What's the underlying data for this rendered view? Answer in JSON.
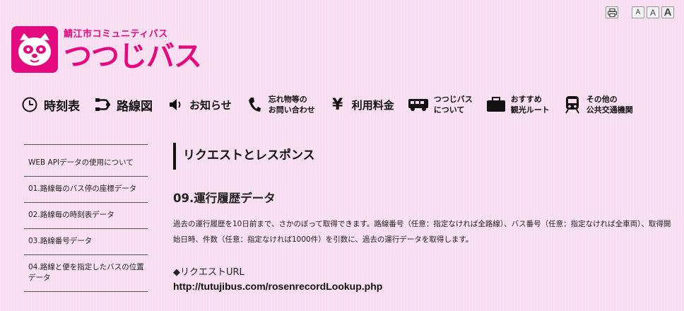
{
  "header": {
    "logo_sub": "鯖江市コミュニティバス",
    "logo_main": "つつじバス",
    "tools": {
      "print_icon": "print-icon",
      "font_small": "A",
      "font_medium": "A",
      "font_large": "A"
    }
  },
  "nav": {
    "items": [
      {
        "icon": "clock-icon",
        "label1": "時刻表",
        "label2": ""
      },
      {
        "icon": "route-map-icon",
        "label1": "路線図",
        "label2": ""
      },
      {
        "icon": "speaker-icon",
        "label1": "お知らせ",
        "label2": ""
      },
      {
        "icon": "phone-icon",
        "label1": "忘れ物等の",
        "label2": "お問い合わせ"
      },
      {
        "icon": "yen-icon",
        "label1": "利用料金",
        "label2": ""
      },
      {
        "icon": "bus-icon",
        "label1": "つつじバス",
        "label2": "について"
      },
      {
        "icon": "suitcase-icon",
        "label1": "おすすめ",
        "label2": "観光ルート"
      },
      {
        "icon": "train-icon",
        "label1": "その他の",
        "label2": "公共交通機関"
      }
    ]
  },
  "sidebar": {
    "items": [
      {
        "label": "WEB APIデータの使用について"
      },
      {
        "label": "01.路線毎のバス停の座標データ"
      },
      {
        "label": "02.路線毎の時刻表データ"
      },
      {
        "label": "03.路線番号データ"
      },
      {
        "label": "04.路線と便を指定したバスの位置データ"
      }
    ]
  },
  "main": {
    "section_title": "リクエストとレスポンス",
    "subtitle": "09.運行履歴データ",
    "description": "過去の運行履歴を10日前まで、さかのぼって取得できます。路線番号（任意：指定なければ全路線）、バス番号（任意：指定なければ全車両）、取得開始日時、件数（任意：指定なければ1000件）を引数に、過去の運行データを取得します。",
    "request_label": "◆リクエストURL",
    "request_url": "http://tutujibus.com/rosenrecordLookup.php"
  },
  "colors": {
    "brand": "#e4097e",
    "background": "#f9dcf0"
  }
}
